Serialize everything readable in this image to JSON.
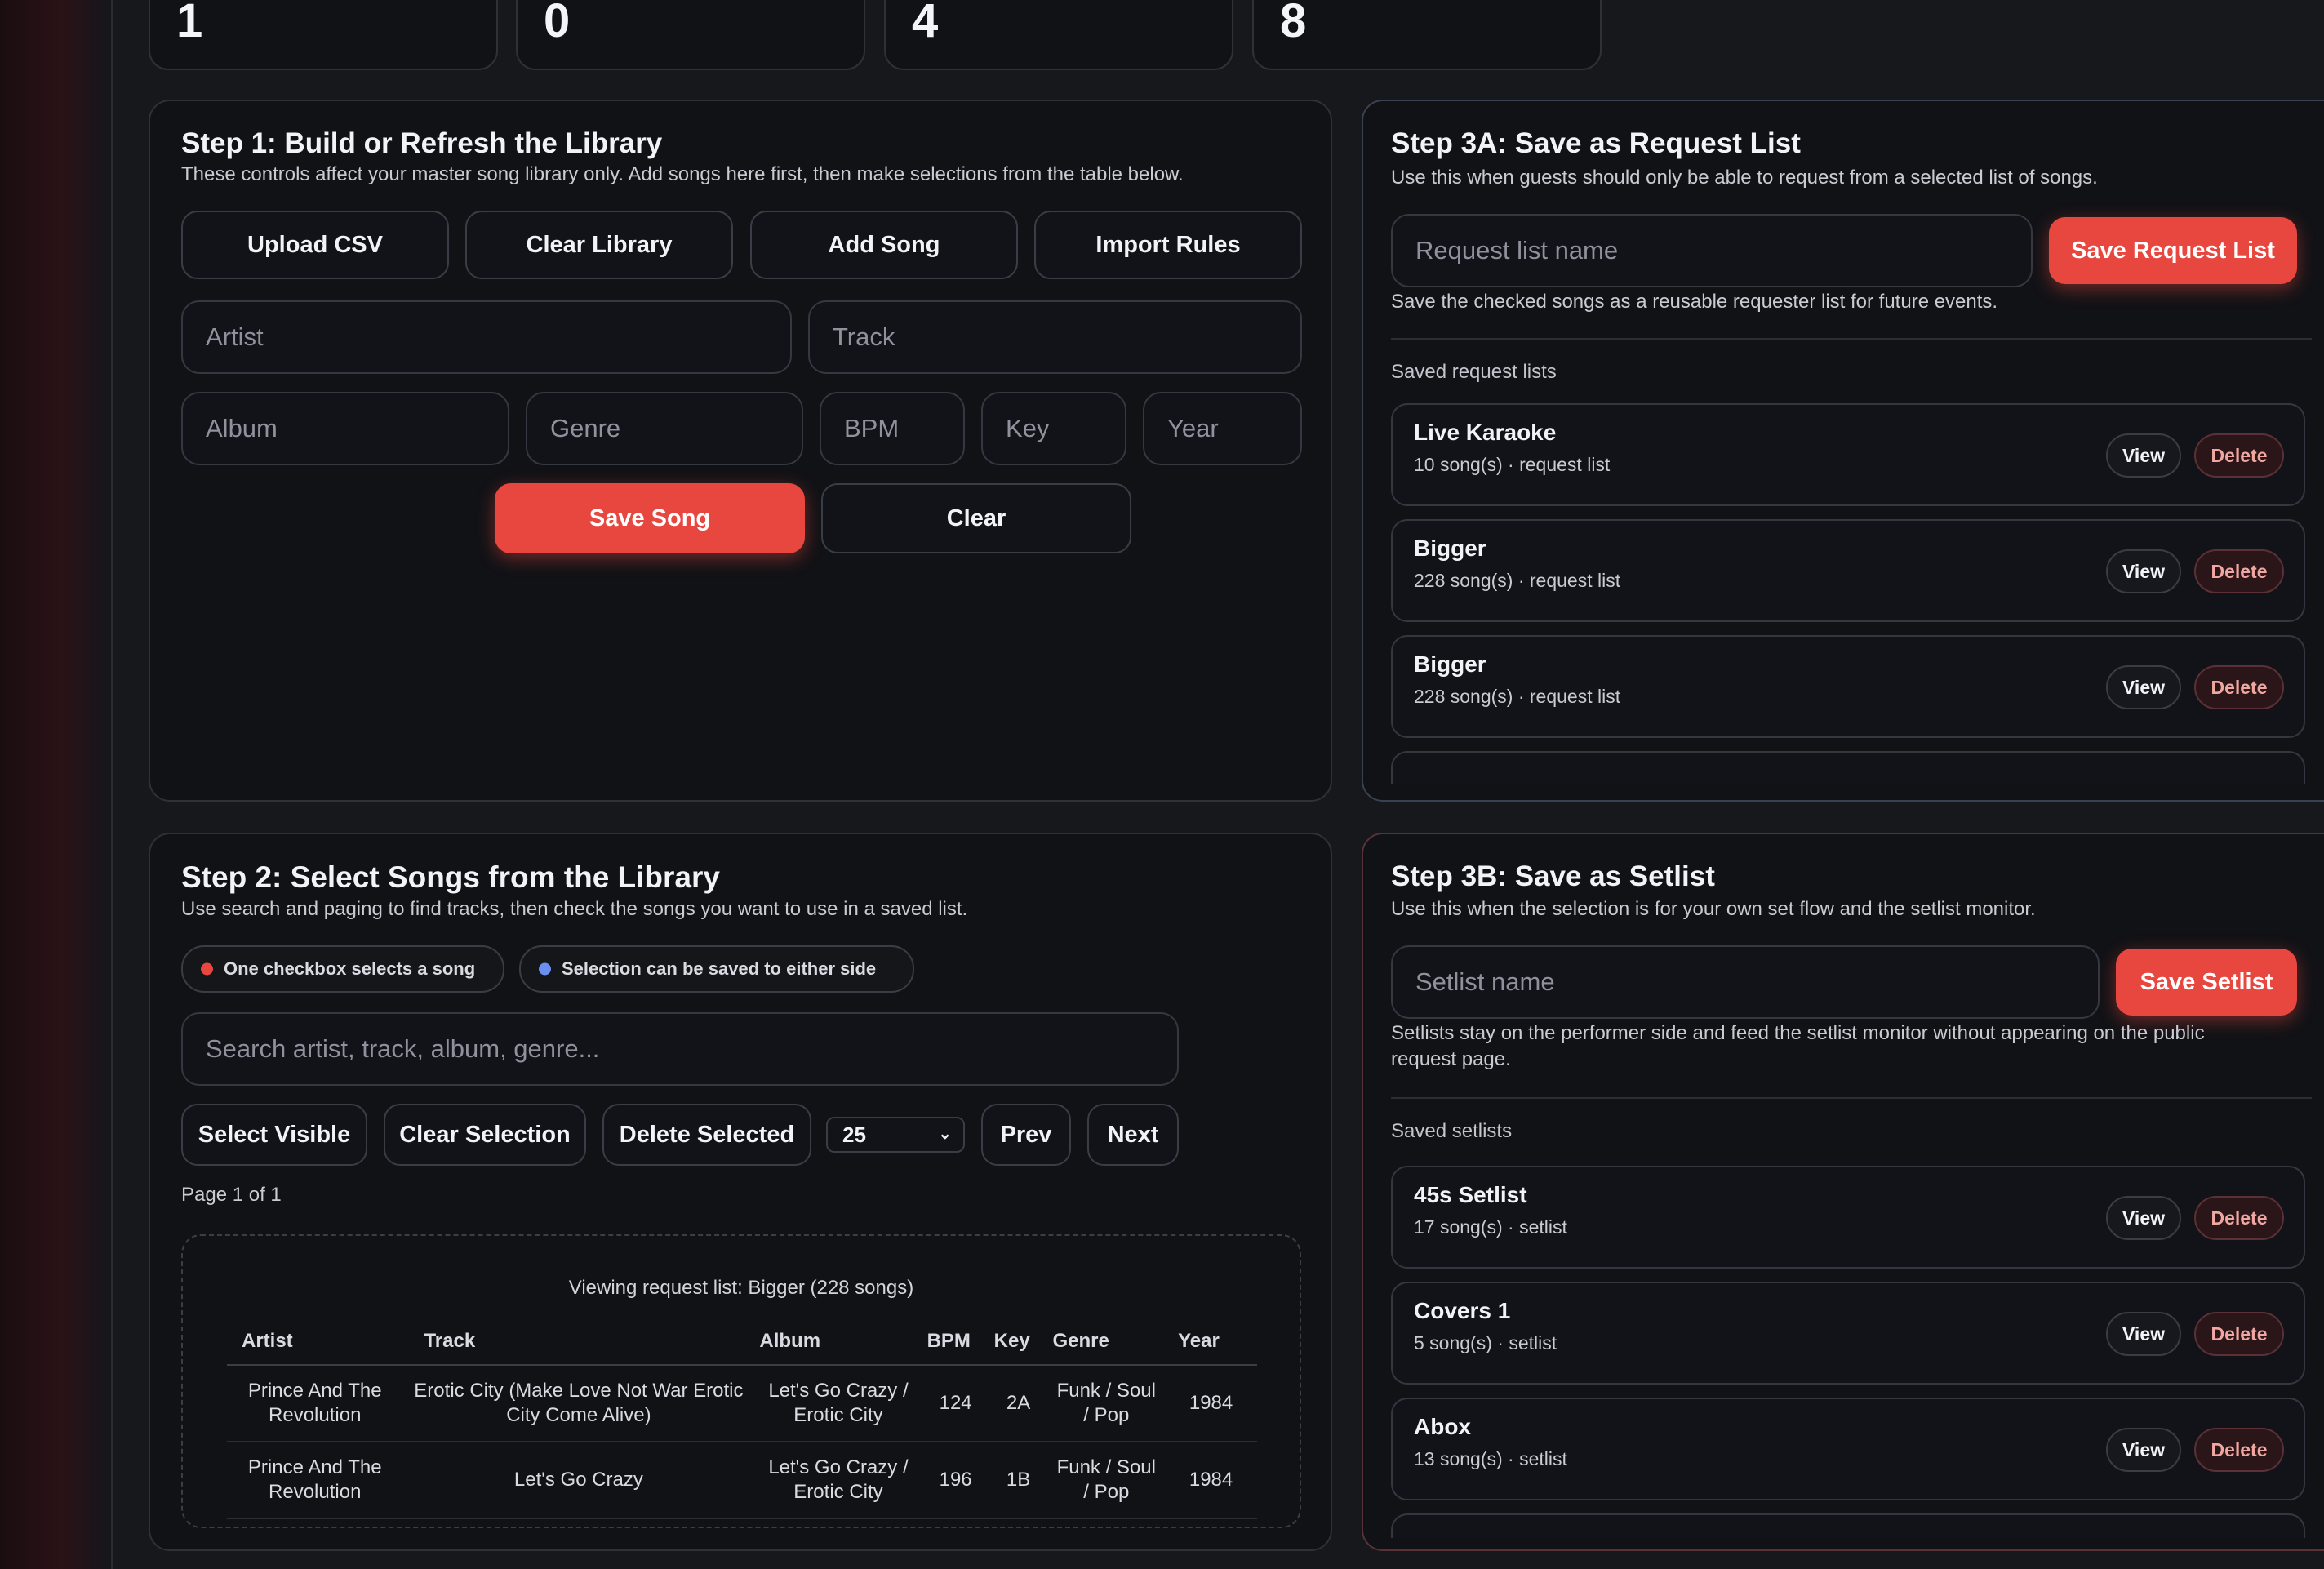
{
  "stats": [
    "1",
    "0",
    "4",
    "8"
  ],
  "step1": {
    "title": "Step 1: Build or Refresh the Library",
    "description": "These controls affect your master song library only. Add songs here first, then make selections from the table below.",
    "buttons": {
      "upload_csv": "Upload CSV",
      "clear_library": "Clear Library",
      "add_song": "Add Song",
      "import_rules": "Import Rules"
    },
    "placeholders": {
      "artist": "Artist",
      "track": "Track",
      "album": "Album",
      "genre": "Genre",
      "bpm": "BPM",
      "key": "Key",
      "year": "Year"
    },
    "save_song": "Save Song",
    "clear": "Clear"
  },
  "step2": {
    "title": "Step 2: Select Songs from the Library",
    "description": "Use search and paging to find tracks, then check the songs you want to use in a saved list.",
    "chips": [
      {
        "label": "One checkbox selects a song",
        "color": "#e8473f"
      },
      {
        "label": "Selection can be saved to either side",
        "color": "#6a8ff0"
      }
    ],
    "search_placeholder": "Search artist, track, album, genre...",
    "buttons": {
      "select_visible": "Select Visible",
      "clear_selection": "Clear Selection",
      "delete_selected": "Delete Selected",
      "prev": "Prev",
      "next": "Next"
    },
    "page_size": "25",
    "page_info": "Page 1 of 1",
    "table": {
      "caption": "Viewing request list: Bigger (228 songs)",
      "headers": [
        "Artist",
        "Track",
        "Album",
        "BPM",
        "Key",
        "Genre",
        "Year"
      ],
      "rows": [
        {
          "artist": "Prince And The Revolution",
          "track": "Erotic City (Make Love Not War Erotic City Come Alive)",
          "album": "Let's Go Crazy / Erotic City",
          "bpm": "124",
          "key": "2A",
          "genre": "Funk / Soul / Pop",
          "year": "1984"
        },
        {
          "artist": "Prince And The Revolution",
          "track": "Let's Go Crazy",
          "album": "Let's Go Crazy / Erotic City",
          "bpm": "196",
          "key": "1B",
          "genre": "Funk / Soul / Pop",
          "year": "1984"
        }
      ]
    }
  },
  "step3a": {
    "title": "Step 3A: Save as Request List",
    "description": "Use this when guests should only be able to request from a selected list of songs.",
    "name_placeholder": "Request list name",
    "save_label": "Save Request List",
    "hint": "Save the checked songs as a reusable requester list for future events.",
    "saved_heading": "Saved request lists",
    "items": [
      {
        "name": "Live Karaoke",
        "meta": "10 song(s) · request list"
      },
      {
        "name": "Bigger",
        "meta": "228 song(s) · request list"
      },
      {
        "name": "Bigger",
        "meta": "228 song(s) · request list"
      }
    ]
  },
  "step3b": {
    "title": "Step 3B: Save as Setlist",
    "description": "Use this when the selection is for your own set flow and the setlist monitor.",
    "name_placeholder": "Setlist name",
    "save_label": "Save Setlist",
    "hint_line1": "Setlists stay on the performer side and feed the setlist monitor without appearing on the public",
    "hint_line2": "request page.",
    "saved_heading": "Saved setlists",
    "items": [
      {
        "name": "45s Setlist",
        "meta": "17 song(s) · setlist"
      },
      {
        "name": "Covers 1",
        "meta": "5 song(s) · setlist"
      },
      {
        "name": "Abox",
        "meta": "13 song(s) · setlist"
      }
    ]
  },
  "item_buttons": {
    "view": "View",
    "delete": "Delete"
  },
  "colors": {
    "accent": "#e8473f",
    "blue_dot": "#6a8ff0",
    "background": "#17181c",
    "panel": "#111216"
  }
}
